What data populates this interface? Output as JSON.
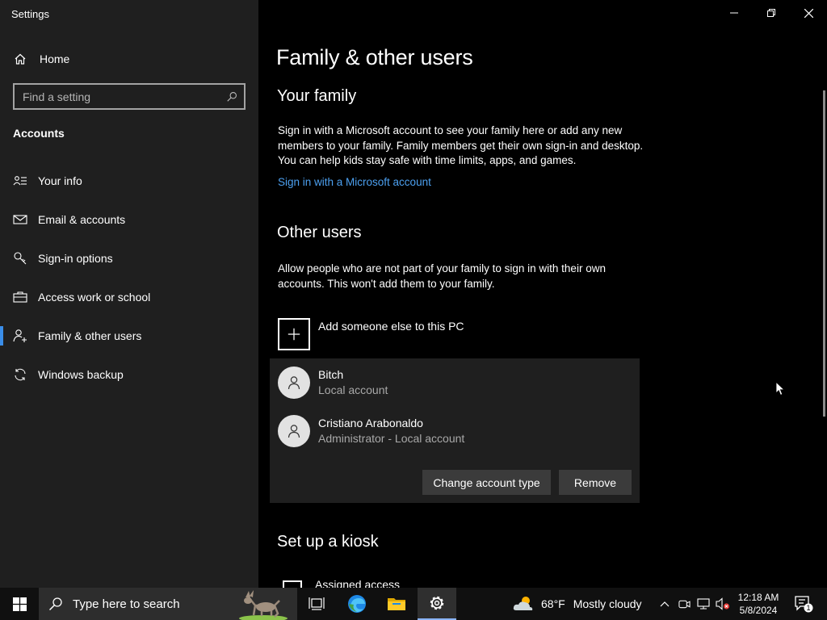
{
  "window": {
    "title": "Settings"
  },
  "sidebar": {
    "home_label": "Home",
    "search_placeholder": "Find a setting",
    "section_label": "Accounts",
    "items": [
      {
        "label": "Your info",
        "icon": "person-card-icon"
      },
      {
        "label": "Email & accounts",
        "icon": "mail-icon"
      },
      {
        "label": "Sign-in options",
        "icon": "key-icon"
      },
      {
        "label": "Access work or school",
        "icon": "briefcase-icon"
      },
      {
        "label": "Family & other users",
        "icon": "person-add-icon",
        "active": true
      },
      {
        "label": "Windows backup",
        "icon": "sync-icon"
      }
    ]
  },
  "main": {
    "title": "Family & other users",
    "your_family": {
      "heading": "Your family",
      "description": "Sign in with a Microsoft account to see your family here or add any new members to your family. Family members get their own sign-in and desktop. You can help kids stay safe with time limits, apps, and games.",
      "link": "Sign in with a Microsoft account"
    },
    "other_users": {
      "heading": "Other users",
      "description": "Allow people who are not part of your family to sign in with their own accounts. This won't add them to your family.",
      "add_label": "Add someone else to this PC",
      "users": [
        {
          "name": "Bitch",
          "type": "Local account"
        },
        {
          "name": "Cristiano Arabonaldo",
          "type": "Administrator - Local account"
        }
      ],
      "change_button": "Change account type",
      "remove_button": "Remove"
    },
    "kiosk": {
      "heading": "Set up a kiosk",
      "item_label": "Assigned access"
    }
  },
  "taskbar": {
    "search_placeholder": "Type here to search",
    "weather": {
      "temp": "68°F",
      "condition": "Mostly cloudy"
    },
    "time": "12:18 AM",
    "date": "5/8/2024",
    "notification_count": "1"
  },
  "colors": {
    "accent": "#3a8de8",
    "link": "#4ca0f0",
    "sidebar_bg": "#1f1f1f",
    "panel_bg": "#1f1f1f",
    "button_bg": "#3b3b3b"
  }
}
